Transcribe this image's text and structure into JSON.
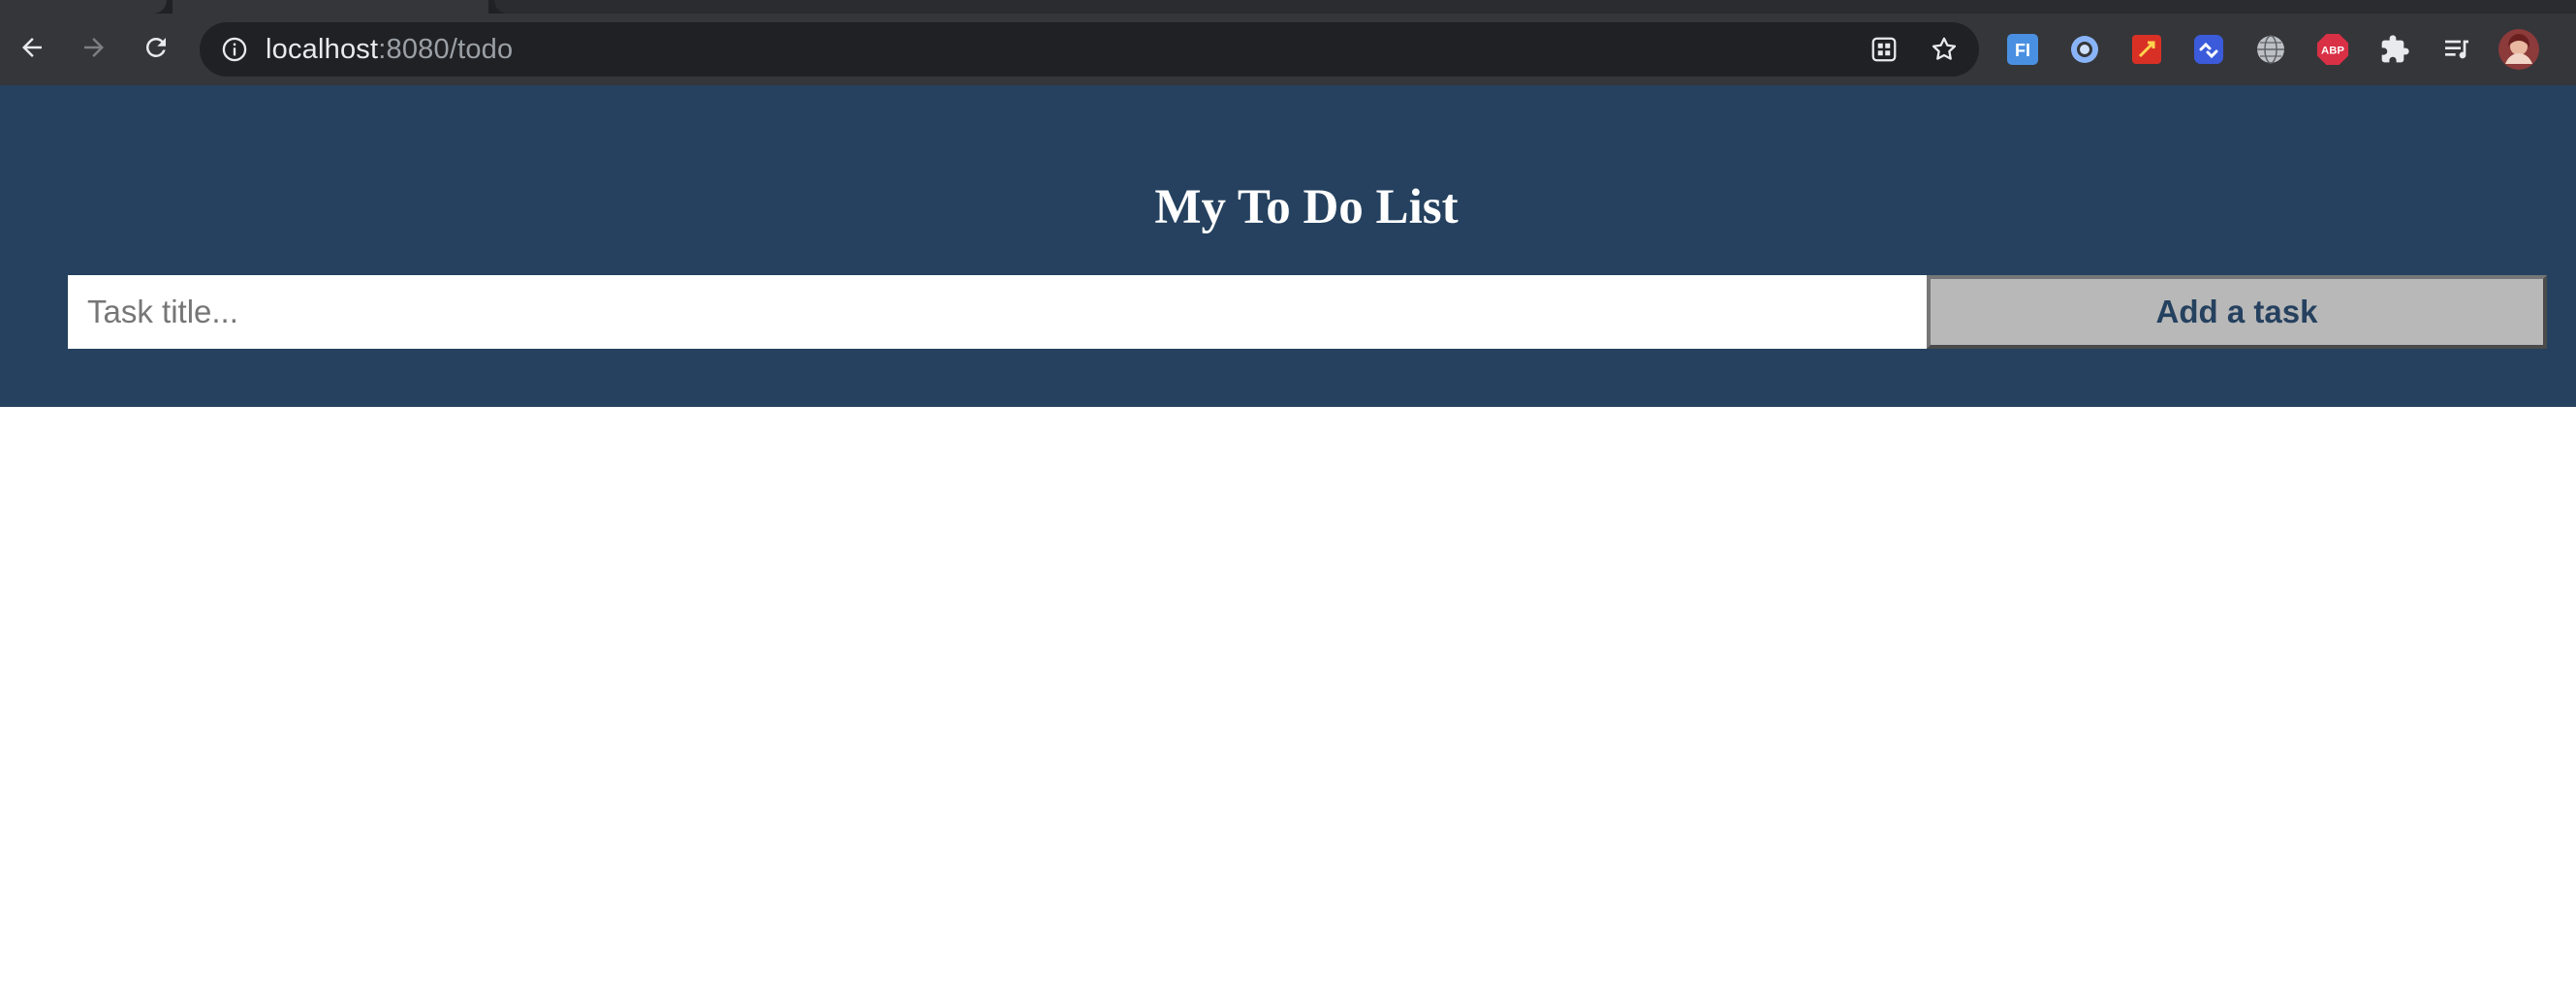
{
  "browser": {
    "url_host": "localhost",
    "url_path": ":8080/todo",
    "colors": {
      "chrome_dark": "#202124",
      "toolbar": "#35363a"
    },
    "toolbar_icons": [
      "back-arrow-icon",
      "forward-arrow-icon",
      "reload-icon",
      "info-icon",
      "qr-code-icon",
      "bookmark-star-icon"
    ],
    "extensions": [
      {
        "name": "fi-extension-icon",
        "text": "FI",
        "color": "#4a90e2"
      },
      {
        "name": "circle-extension-icon",
        "color": "#8ab4f8"
      },
      {
        "name": "red-square-extension-icon",
        "color": "#d93025"
      },
      {
        "name": "blue-link-extension-icon",
        "color": "#3b5bdb"
      },
      {
        "name": "globe-extension-icon",
        "color": "#bdc1c6"
      },
      {
        "name": "adblock-plus-icon",
        "text": "ABP",
        "color": "#d93045"
      },
      {
        "name": "puzzle-extensions-icon",
        "color": "#e8eaed"
      },
      {
        "name": "reading-list-icon",
        "color": "#e8eaed"
      },
      {
        "name": "profile-avatar",
        "color": "#8c3a3a"
      }
    ]
  },
  "page": {
    "title": "My To Do List",
    "input_placeholder": "Task title...",
    "input_value": "",
    "add_button_label": "Add a task",
    "colors": {
      "header_bg": "#25415f",
      "button_bg": "#b8b8b8",
      "button_text": "#25415f"
    }
  }
}
